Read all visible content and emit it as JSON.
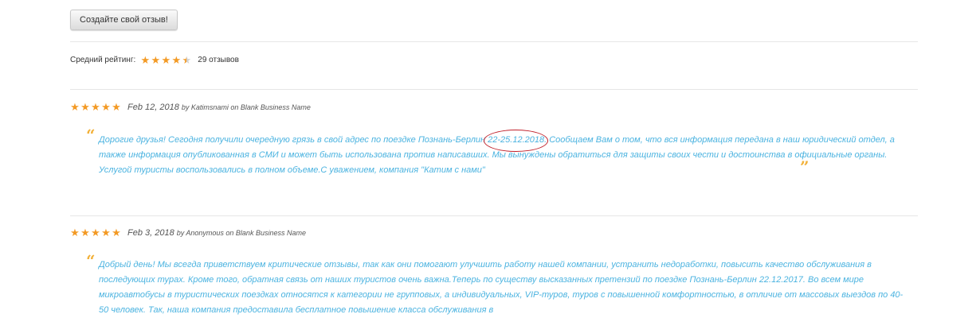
{
  "create_review_button": "Создайте свой отзыв!",
  "average": {
    "label": "Средний рейтинг:",
    "rating": 4.5,
    "count_text": "29 отзывов"
  },
  "reviews": [
    {
      "rating": 5,
      "date": "Feb 12, 2018",
      "meta": "by Katimsnami on Blank Business Name",
      "text_before": "Дорогие друзья! Сегодня получили очередную грязь в свой адрес по поездке Познань-Берлин ",
      "highlight": "22-25.12.2018",
      "text_after": ". Сообщаем Вам о том, что вся информация передана в наш юридический отдел, а также информация опубликованная в СМИ и может быть использована против написавших. Мы вынуждены обратиться для защиты своих чести и достоинства в официальные органы. Услугой туристы воспользовались в полном объеме.С уважением, компания \"Катим с нами\""
    },
    {
      "rating": 5,
      "date": "Feb 3, 2018",
      "meta": "by Anonymous on Blank Business Name",
      "text": "Добрый день! Мы всегда приветствуем критические отзывы, так как они помогают улучшить  работу нашей компании, устранить недоработки, повысить качество обслуживания в последующих турах. Кроме того, обратная связь от наших туристов очень важна.Теперь по существу высказанных претензий по поездке Познань-Берлин 22.12.2017. Во всем мире микроавтобусы в туристических поездках относятся к категории не групповых, а индивидуальных, VIP-туров, туров с повышенной комфортностью, в отличие от массовых выездов по 40-50 человек. Так, наша компания предоставила бесплатное повышение класса обслуживания в"
    }
  ],
  "colors": {
    "star": "#f39a25",
    "review_text": "#4bb3e0",
    "quote_mark": "#f2b13a",
    "highlight_ring": "#c0202a"
  }
}
